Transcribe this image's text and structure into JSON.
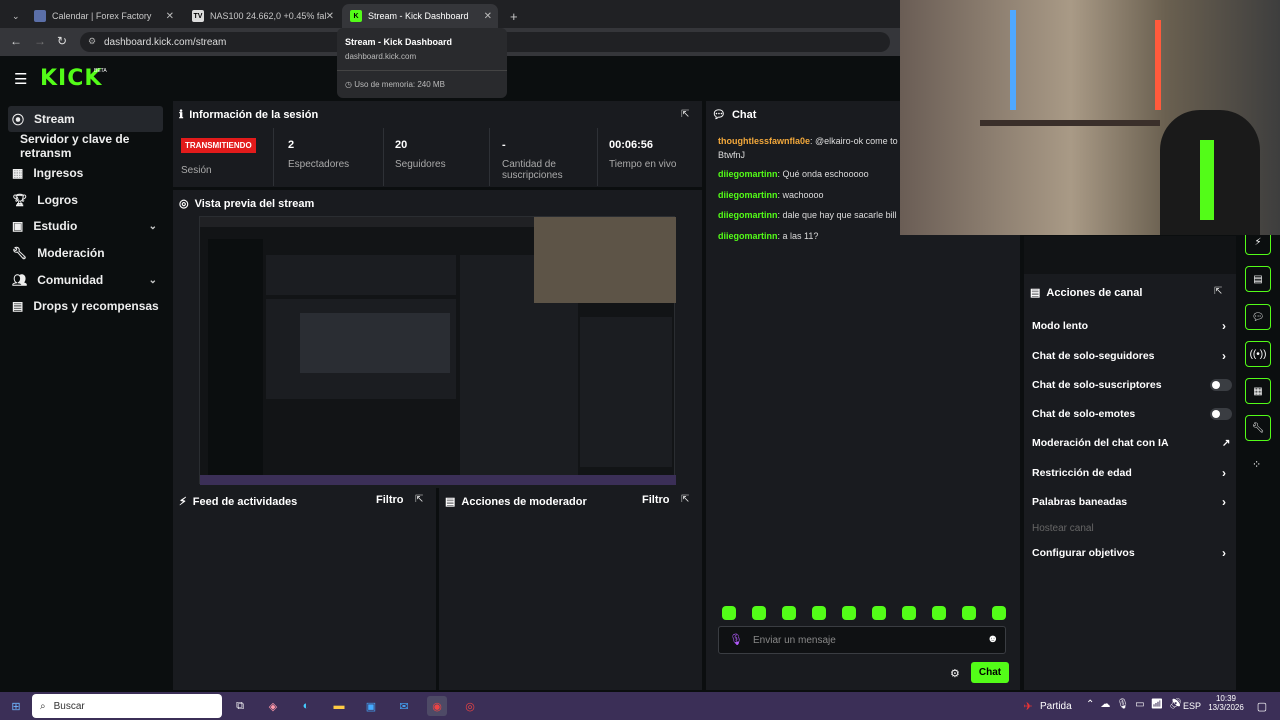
{
  "browser": {
    "tabs": [
      {
        "title": "Calendar | Forex Factory"
      },
      {
        "title": "NAS100 24.662,0 +0.45% fal"
      },
      {
        "title": "Stream - Kick Dashboard"
      }
    ],
    "url": "dashboard.kick.com/stream",
    "tooltip": {
      "title": "Stream - Kick Dashboard",
      "domain": "dashboard.kick.com",
      "memory": "Uso de memoria: 240 MB"
    }
  },
  "brand": {
    "logo": "KICK",
    "beta": "BETA"
  },
  "sidebar": {
    "items": [
      {
        "label": "Stream"
      },
      {
        "label": "Servidor y clave de retransm"
      },
      {
        "label": "Ingresos"
      },
      {
        "label": "Logros"
      },
      {
        "label": "Estudio"
      },
      {
        "label": "Moderación"
      },
      {
        "label": "Comunidad"
      },
      {
        "label": "Drops y recompensas"
      }
    ]
  },
  "session": {
    "title": "Información de la sesión",
    "status": "TRANSMITIENDO",
    "status_label": "Sesión",
    "stats": [
      {
        "value": "2",
        "label": "Espectadores"
      },
      {
        "value": "20",
        "label": "Seguidores"
      },
      {
        "value": "-",
        "label": "Cantidad de suscripciones"
      },
      {
        "value": "00:06:56",
        "label": "Tiempo en vivo"
      }
    ]
  },
  "preview": {
    "title": "Vista previa del stream"
  },
  "activity": {
    "title": "Feed de actividades",
    "filter": "Filtro"
  },
  "modactions": {
    "title": "Acciones de moderador",
    "filter": "Filtro"
  },
  "chat": {
    "title": "Chat",
    "messages": [
      {
        "user": "thoughtlessfawnfla0e",
        "text": ": @elkairo-ok come to BtwfnJ"
      },
      {
        "user": "diiegomartinn",
        "text": ": Qué onda eschooooo"
      },
      {
        "user": "diiegomartinn",
        "text": ": wachoooo"
      },
      {
        "user": "diiegomartinn",
        "text": ": dale que hay que sacarle bill"
      },
      {
        "user": "diiegomartinn",
        "text": ": a las 11?"
      }
    ],
    "placeholder": "Enviar un mensaje",
    "send": "Chat"
  },
  "channel_actions": {
    "title": "Acciones de canal",
    "items": [
      {
        "label": "Modo lento"
      },
      {
        "label": "Chat de solo-seguidores"
      },
      {
        "label": "Chat de solo-suscriptores"
      },
      {
        "label": "Chat de solo-emotes"
      },
      {
        "label": "Moderación del chat con IA"
      },
      {
        "label": "Restricción de edad"
      },
      {
        "label": "Palabras baneadas"
      },
      {
        "label": "Hostear canal"
      },
      {
        "label": "Configurar objetivos"
      }
    ]
  },
  "taskbar": {
    "search": "Buscar",
    "weather": "Partida",
    "lang": "ESP",
    "time": "10:39",
    "date": "13/3/2026"
  },
  "colors": {
    "accent": "#53fc18",
    "live": "#e21b1b",
    "bg": "#0b0e0f",
    "panel": "#191b1f",
    "taskbar": "#3b2f57"
  }
}
